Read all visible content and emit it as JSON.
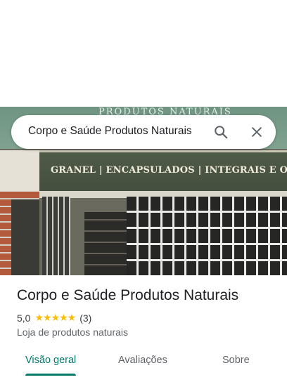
{
  "search": {
    "query": "Corpo e Saúde Produtos Naturais"
  },
  "photo": {
    "top_text": "PRODUTOS NATURAIS",
    "sign_text": "GRANEL | ENCAPSULADOS | INTEGRAIS E ORGÂNICO"
  },
  "place": {
    "title": "Corpo e Saúde Produtos Naturais",
    "rating": "5,0",
    "stars": "★★★★★",
    "review_count": "(3)",
    "category": "Loja de produtos naturais"
  },
  "tabs": [
    {
      "label": "Visão geral",
      "active": true
    },
    {
      "label": "Avaliações",
      "active": false
    },
    {
      "label": "Sobre",
      "active": false
    }
  ],
  "colors": {
    "accent": "#00796b",
    "star": "#fbbc04"
  }
}
